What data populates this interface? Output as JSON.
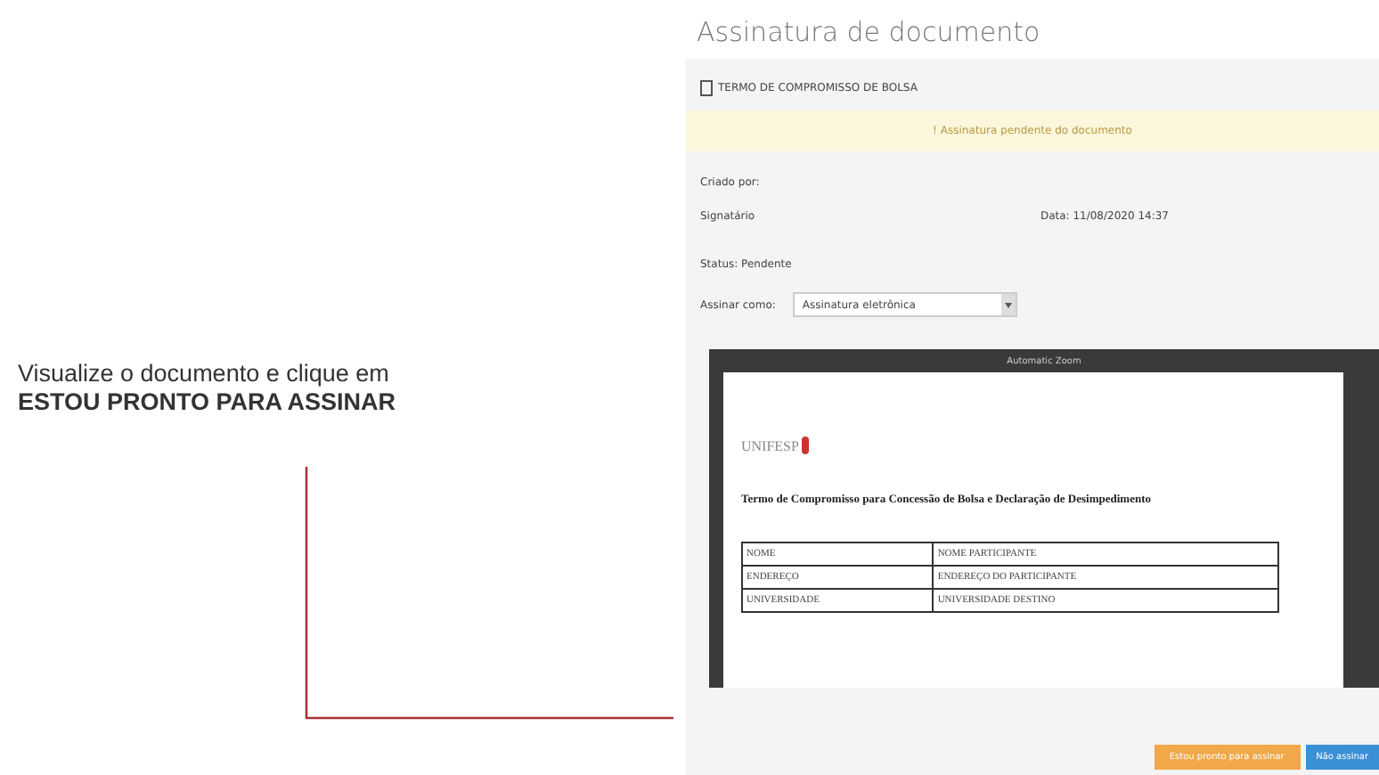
{
  "annotation": {
    "text": "Visualize o documento e clique em",
    "emphasis": "ESTOU PRONTO PARA ASSINAR"
  },
  "page": {
    "title": "Assinatura de documento"
  },
  "panel": {
    "heading": "TERMO DE COMPROMISSO DE BOLSA",
    "alert": "! Assinatura pendente do documento",
    "created_by": "Criado por:",
    "signatory": "Signatário",
    "date": "Data: 11/08/2020 14:37",
    "status": "Status: Pendente",
    "sign_as_label": "Assinar como:",
    "sign_as_value": "Assinatura eletrônica"
  },
  "viewer": {
    "page_label": "Automatic Zoom",
    "logo": "UNIFESP",
    "doc_title": "Termo de Compromisso para Concessão de Bolsa e Declaração de Desimpedimento",
    "rows": [
      [
        "NOME",
        "NOME PARTICIPANTE"
      ],
      [
        "ENDEREÇO",
        "ENDEREÇO DO PARTICIPANTE"
      ],
      [
        "UNIVERSIDADE",
        "UNIVERSIDADE DESTINO"
      ]
    ]
  },
  "buttons": [
    {
      "label": "Estou pronto para assinar",
      "kind": "primary"
    },
    {
      "label": "Não assinar",
      "kind": "secondary"
    }
  ]
}
